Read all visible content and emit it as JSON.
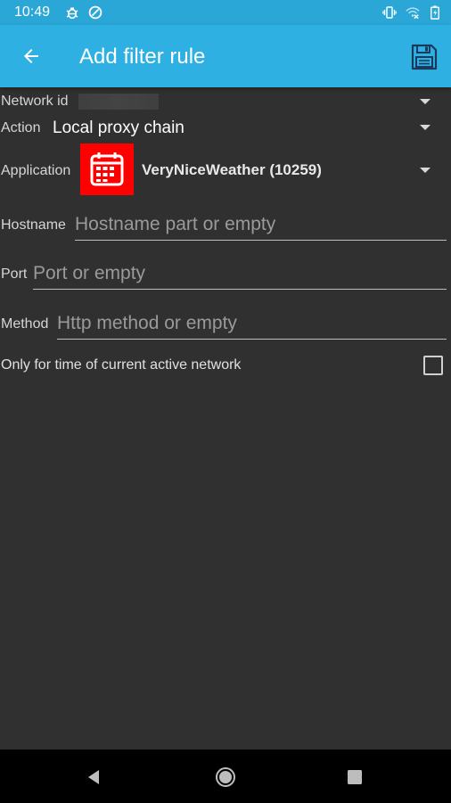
{
  "status_bar": {
    "time": "10:49",
    "icons": [
      "bug-icon",
      "data-saver-icon",
      "vibrate-icon",
      "wifi-off-icon",
      "battery-charging-icon"
    ],
    "background": "#2aa7d7"
  },
  "app_bar": {
    "title": "Add filter rule",
    "back_icon": "arrow-left-icon",
    "save_icon": "floppy-disk-icon",
    "background": "#2fb0e3"
  },
  "form": {
    "network_id": {
      "label": "Network id",
      "value_redacted": true
    },
    "action": {
      "label": "Action",
      "value": "Local proxy chain"
    },
    "application": {
      "label": "Application",
      "value": "VeryNiceWeather (10259)",
      "icon": "calendar-icon",
      "icon_color": "#ff0000"
    },
    "hostname": {
      "label": "Hostname",
      "placeholder": "Hostname part or empty",
      "value": ""
    },
    "port": {
      "label": "Port",
      "placeholder": "Port or empty",
      "value": ""
    },
    "method": {
      "label": "Method",
      "placeholder": "Http method or empty",
      "value": ""
    },
    "current_network_only": {
      "label": "Only for time of current active network",
      "checked": false
    }
  },
  "nav_bar": {
    "buttons": [
      "back-triangle-icon",
      "home-circle-icon",
      "recents-square-icon"
    ]
  }
}
